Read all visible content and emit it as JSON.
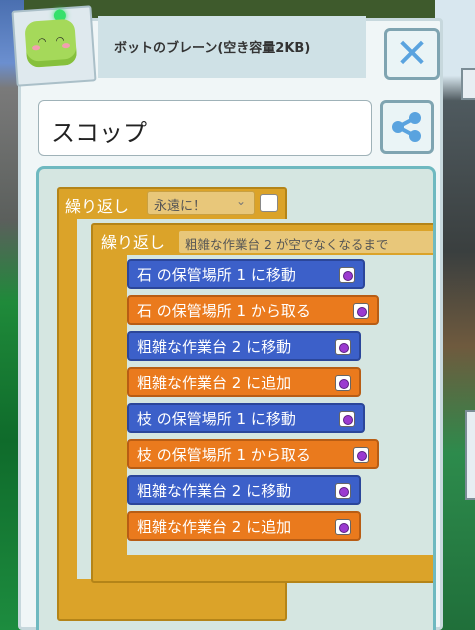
{
  "header": {
    "title": "ボットのブレーン(空き容量2KB)",
    "close_icon": "close-x-icon",
    "avatar_icon": "bot-face-icon"
  },
  "name_field": {
    "value": "スコップ"
  },
  "share_icon": "share-icon",
  "program": {
    "outer_loop": {
      "label": "繰り返し",
      "mode_selected": "永遠に！",
      "checkbox_checked": false
    },
    "inner_loop": {
      "label": "繰り返し",
      "condition": "粗雑な作業台 2 が空でなくなるまで"
    },
    "commands": [
      {
        "text": "石 の保管場所 1 に移動",
        "color": "#3c60c9"
      },
      {
        "text": "石 の保管場所 1 から取る",
        "color": "#ea7a1d"
      },
      {
        "text": "粗雑な作業台 2 に移動",
        "color": "#3c60c9"
      },
      {
        "text": "粗雑な作業台 2 に追加",
        "color": "#ea7a1d"
      },
      {
        "text": "枝 の保管場所 1 に移動",
        "color": "#3c60c9"
      },
      {
        "text": "枝 の保管場所 1 から取る",
        "color": "#ea7a1d"
      },
      {
        "text": "粗雑な作業台 2 に移動",
        "color": "#3c60c9"
      },
      {
        "text": "粗雑な作業台 2 に追加",
        "color": "#ea7a1d"
      }
    ]
  },
  "colors": {
    "loop_block": "#dba329",
    "move_block": "#3c60c9",
    "action_block": "#ea7a1d",
    "workspace_bg": "#d5e6e1",
    "workspace_border": "#6fb9c0"
  }
}
